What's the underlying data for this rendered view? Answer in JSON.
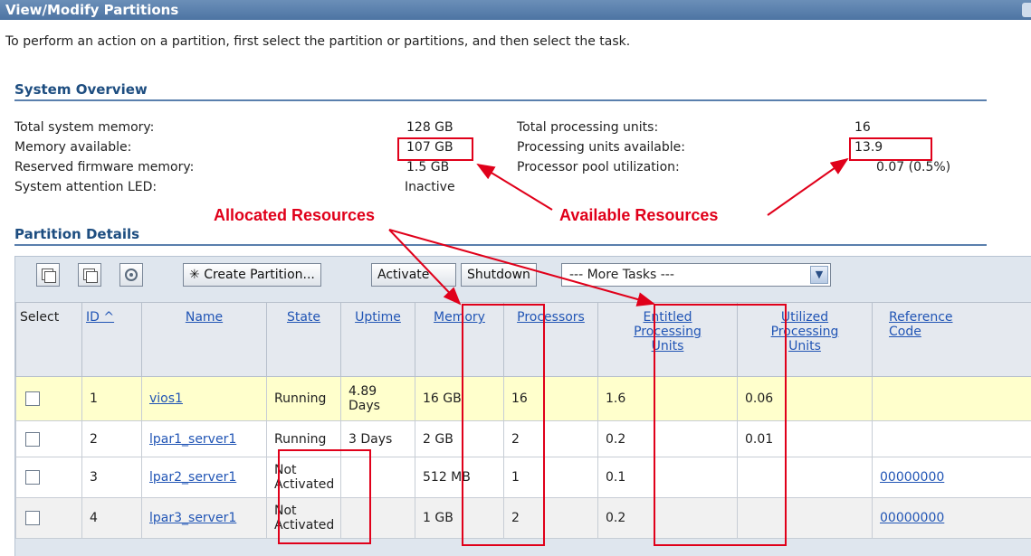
{
  "window": {
    "title": "View/Modify Partitions"
  },
  "intro": "To perform an action on a partition, first select the partition or partitions, and then select the task.",
  "system_overview": {
    "title": "System Overview",
    "left": [
      {
        "label": "Total system memory:",
        "value": "128 GB"
      },
      {
        "label": "Memory available:",
        "value": "107 GB"
      },
      {
        "label": "Reserved firmware memory:",
        "value": "1.5 GB"
      },
      {
        "label": "System attention LED:",
        "value": "Inactive"
      }
    ],
    "right": [
      {
        "label": "Total processing units:",
        "value": "16"
      },
      {
        "label": "Processing units available:",
        "value": "13.9"
      },
      {
        "label": "Processor pool utilization:",
        "value": "0.07 (0.5%)"
      }
    ]
  },
  "partition_details": {
    "title": "Partition Details",
    "toolbar": {
      "create_label": "Create Partition...",
      "activate_label": "Activate",
      "shutdown_label": "Shutdown",
      "more_tasks": "--- More Tasks ---"
    },
    "columns": {
      "select": "Select",
      "id": "ID ^",
      "name": "Name",
      "state": "State",
      "uptime": "Uptime",
      "memory": "Memory",
      "processors": "Processors",
      "entitled": "Entitled Processing Units",
      "utilized": "Utilized Processing Units",
      "reference": "Reference Code"
    },
    "rows": [
      {
        "id": "1",
        "name": "vios1",
        "state": "Running",
        "uptime": "4.89 Days",
        "memory": "16 GB",
        "processors": "16",
        "entitled": "1.6",
        "utilized": "0.06",
        "reference": ""
      },
      {
        "id": "2",
        "name": "lpar1_server1",
        "state": "Running",
        "uptime": "3 Days",
        "memory": "2 GB",
        "processors": "2",
        "entitled": "0.2",
        "utilized": "0.01",
        "reference": ""
      },
      {
        "id": "3",
        "name": "lpar2_server1",
        "state": "Not Activated",
        "uptime": "",
        "memory": "512 MB",
        "processors": "1",
        "entitled": "0.1",
        "utilized": "",
        "reference": "00000000"
      },
      {
        "id": "4",
        "name": "lpar3_server1",
        "state": "Not Activated",
        "uptime": "",
        "memory": "1 GB",
        "processors": "2",
        "entitled": "0.2",
        "utilized": "",
        "reference": "00000000"
      }
    ]
  },
  "annotations": {
    "allocated": "Allocated Resources",
    "available": "Available Resources"
  },
  "colors": {
    "annotation": "#e0001a",
    "title_bar": "#4d74a3",
    "section_title": "#1d4d80"
  }
}
